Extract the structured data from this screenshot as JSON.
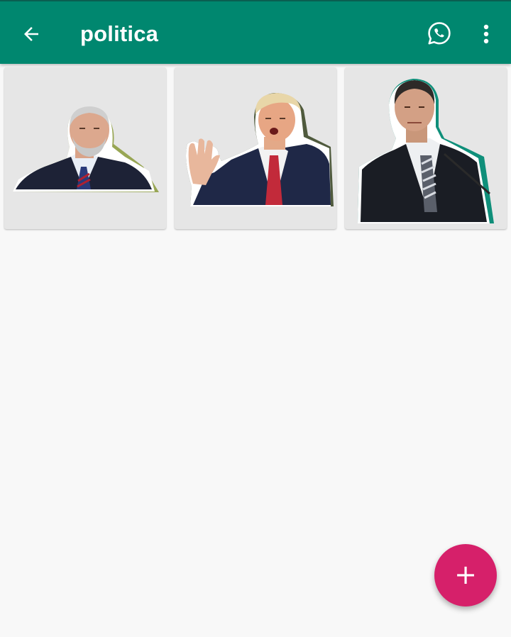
{
  "appbar": {
    "title": "politica",
    "back_icon": "arrow-left-icon",
    "whatsapp_icon": "whatsapp-icon",
    "more_icon": "more-vert-icon"
  },
  "stickers": [
    {
      "name": "sticker-1",
      "outline_color": "#8a9a3a"
    },
    {
      "name": "sticker-2",
      "outline_color": "#4a5a2a"
    },
    {
      "name": "sticker-3",
      "outline_color": "#0f8f7a"
    }
  ],
  "fab": {
    "label": "+",
    "icon": "add-icon"
  },
  "colors": {
    "appbar": "#00876f",
    "fab": "#d6206a",
    "background": "#f8f8f8",
    "tile": "#e6e6e6"
  }
}
